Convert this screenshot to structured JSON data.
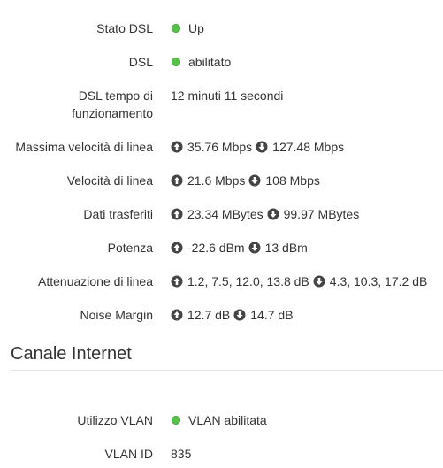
{
  "colors": {
    "status_dot": "#58c14a",
    "arrow_icon": "#444444",
    "text": "#333333",
    "divider": "#e4e4e4"
  },
  "dsl": {
    "status": {
      "label": "Stato DSL",
      "value": "Up",
      "icon": "status-dot-green"
    },
    "dsl": {
      "label": "DSL",
      "value": "abilitato",
      "icon": "status-dot-green"
    },
    "uptime": {
      "label_line1": "DSL tempo di",
      "label_line2": "funzionamento",
      "value": "12 minuti 11 secondi"
    },
    "max_line_rate": {
      "label": "Massima velocità di linea",
      "up": "35.76 Mbps",
      "down": "127.48 Mbps"
    },
    "line_rate": {
      "label": "Velocità di linea",
      "up": "21.6 Mbps",
      "down": "108 Mbps"
    },
    "data_transferred": {
      "label": "Dati trasferiti",
      "up": "23.34 MBytes",
      "down": "99.97 MBytes"
    },
    "power": {
      "label": "Potenza",
      "up": "-22.6 dBm",
      "down": "13 dBm"
    },
    "attenuation": {
      "label": "Attenuazione di linea",
      "up": "1.2, 7.5, 12.0, 13.8 dB",
      "down": "4.3, 10.3, 17.2 dB"
    },
    "noise_margin": {
      "label": "Noise Margin",
      "up": "12.7 dB",
      "down": "14.7 dB"
    }
  },
  "internet": {
    "title": "Canale Internet",
    "vlan_usage": {
      "label": "Utilizzo VLAN",
      "value": "VLAN abilitata",
      "icon": "status-dot-green"
    },
    "vlan_id": {
      "label": "VLAN ID",
      "value": "835"
    }
  }
}
